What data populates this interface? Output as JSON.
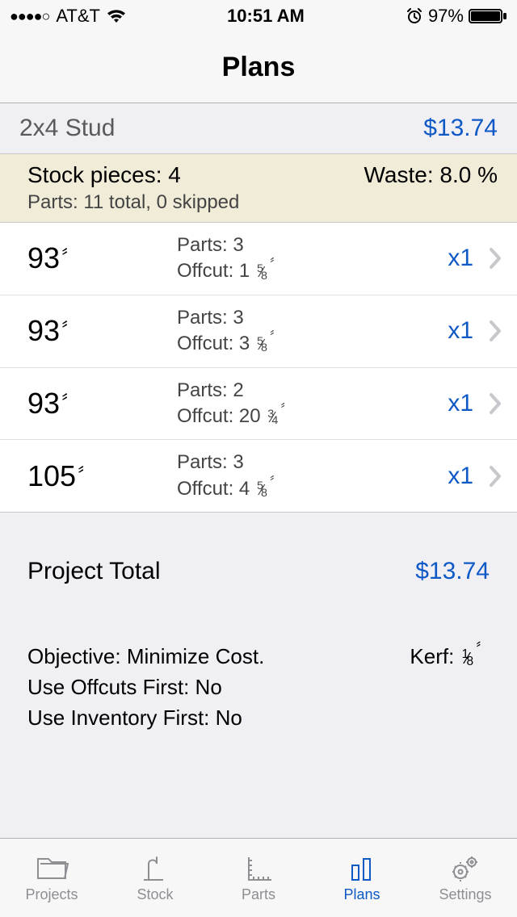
{
  "status": {
    "signal_dots": "●●●●○",
    "carrier": "AT&T",
    "time": "10:51 AM",
    "battery_pct": "97%"
  },
  "nav": {
    "title": "Plans"
  },
  "material": {
    "name": "2x4 Stud",
    "price": "$13.74"
  },
  "summary": {
    "stock_label": "Stock pieces: 4",
    "waste_label": "Waste: 8.0 %",
    "parts_label": "Parts: 11 total,  0 skipped"
  },
  "cuts": [
    {
      "length": "93",
      "parts": "Parts: 3",
      "offcut_int": "1",
      "offcut_num": "5",
      "offcut_den": "8",
      "qty": "x1"
    },
    {
      "length": "93",
      "parts": "Parts: 3",
      "offcut_int": "3",
      "offcut_num": "5",
      "offcut_den": "8",
      "qty": "x1"
    },
    {
      "length": "93",
      "parts": "Parts: 2",
      "offcut_int": "20",
      "offcut_num": "3",
      "offcut_den": "4",
      "qty": "x1"
    },
    {
      "length": "105",
      "parts": "Parts: 3",
      "offcut_int": "4",
      "offcut_num": "5",
      "offcut_den": "8",
      "qty": "x1"
    }
  ],
  "totals": {
    "label": "Project Total",
    "price": "$13.74"
  },
  "details": {
    "objective": "Objective: Minimize Cost.",
    "kerf_label": "Kerf:",
    "kerf_num": "1",
    "kerf_den": "8",
    "offcuts": "Use Offcuts First: No",
    "inventory": "Use Inventory First: No"
  },
  "tabs": {
    "projects": "Projects",
    "stock": "Stock",
    "parts": "Parts",
    "plans": "Plans",
    "settings": "Settings"
  },
  "labels": {
    "offcut_prefix": "Offcut: "
  }
}
